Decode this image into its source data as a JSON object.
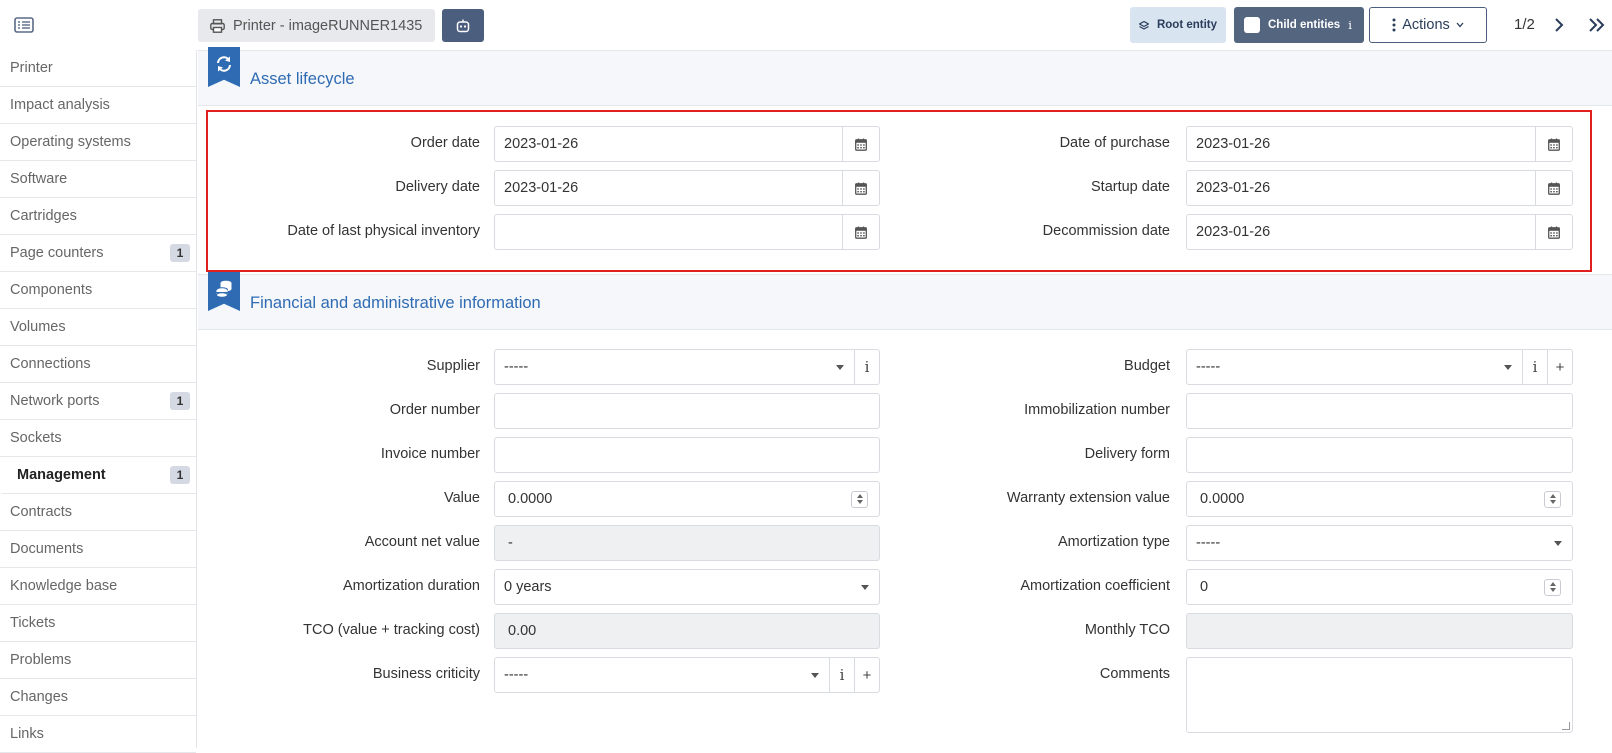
{
  "topbar": {
    "tab_title": "Printer - imageRUNNER1435",
    "root_entity": "Root entity",
    "child_entities": "Child entities",
    "child_info": "i",
    "actions": "Actions",
    "pager": "1/2"
  },
  "sidebar": {
    "items": [
      {
        "label": "Printer",
        "badge": ""
      },
      {
        "label": "Impact analysis",
        "badge": ""
      },
      {
        "label": "Operating systems",
        "badge": ""
      },
      {
        "label": "Software",
        "badge": ""
      },
      {
        "label": "Cartridges",
        "badge": ""
      },
      {
        "label": "Page counters",
        "badge": "1"
      },
      {
        "label": "Components",
        "badge": ""
      },
      {
        "label": "Volumes",
        "badge": ""
      },
      {
        "label": "Connections",
        "badge": ""
      },
      {
        "label": "Network ports",
        "badge": "1"
      },
      {
        "label": "Sockets",
        "badge": ""
      },
      {
        "label": "Management",
        "badge": "1"
      },
      {
        "label": "Contracts",
        "badge": ""
      },
      {
        "label": "Documents",
        "badge": ""
      },
      {
        "label": "Knowledge base",
        "badge": ""
      },
      {
        "label": "Tickets",
        "badge": ""
      },
      {
        "label": "Problems",
        "badge": ""
      },
      {
        "label": "Changes",
        "badge": ""
      },
      {
        "label": "Links",
        "badge": ""
      }
    ],
    "active_index": 11
  },
  "lifecycle": {
    "title": "Asset lifecycle",
    "order_date": {
      "label": "Order date",
      "value": "2023-01-26"
    },
    "purchase_date": {
      "label": "Date of purchase",
      "value": "2023-01-26"
    },
    "delivery_date": {
      "label": "Delivery date",
      "value": "2023-01-26"
    },
    "startup_date": {
      "label": "Startup date",
      "value": "2023-01-26"
    },
    "inventory_date": {
      "label": "Date of last physical inventory",
      "value": ""
    },
    "decommission_date": {
      "label": "Decommission date",
      "value": "2023-01-26"
    }
  },
  "financial": {
    "title": "Financial and administrative information",
    "supplier": {
      "label": "Supplier",
      "value": "-----"
    },
    "budget": {
      "label": "Budget",
      "value": "-----"
    },
    "order_number": {
      "label": "Order number",
      "value": ""
    },
    "immobilization_number": {
      "label": "Immobilization number",
      "value": ""
    },
    "invoice_number": {
      "label": "Invoice number",
      "value": ""
    },
    "delivery_form": {
      "label": "Delivery form",
      "value": ""
    },
    "value": {
      "label": "Value",
      "value": "0.0000"
    },
    "warranty_value": {
      "label": "Warranty extension value",
      "value": "0.0000"
    },
    "account_net_value": {
      "label": "Account net value",
      "value": "-"
    },
    "amortization_type": {
      "label": "Amortization type",
      "value": "-----"
    },
    "amortization_duration": {
      "label": "Amortization duration",
      "value": "0 years"
    },
    "amortization_coefficient": {
      "label": "Amortization coefficient",
      "value": "0"
    },
    "tco": {
      "label": "TCO (value + tracking cost)",
      "value": "0.00"
    },
    "monthly_tco": {
      "label": "Monthly TCO",
      "value": ""
    },
    "business_criticity": {
      "label": "Business criticity",
      "value": "-----"
    },
    "comments": {
      "label": "Comments",
      "value": ""
    }
  },
  "addons": {
    "info": "i",
    "plus": "+"
  },
  "colors": {
    "accent": "#2f6bb3",
    "highlight": "#e02020",
    "dark_button": "#4c5e7d"
  }
}
